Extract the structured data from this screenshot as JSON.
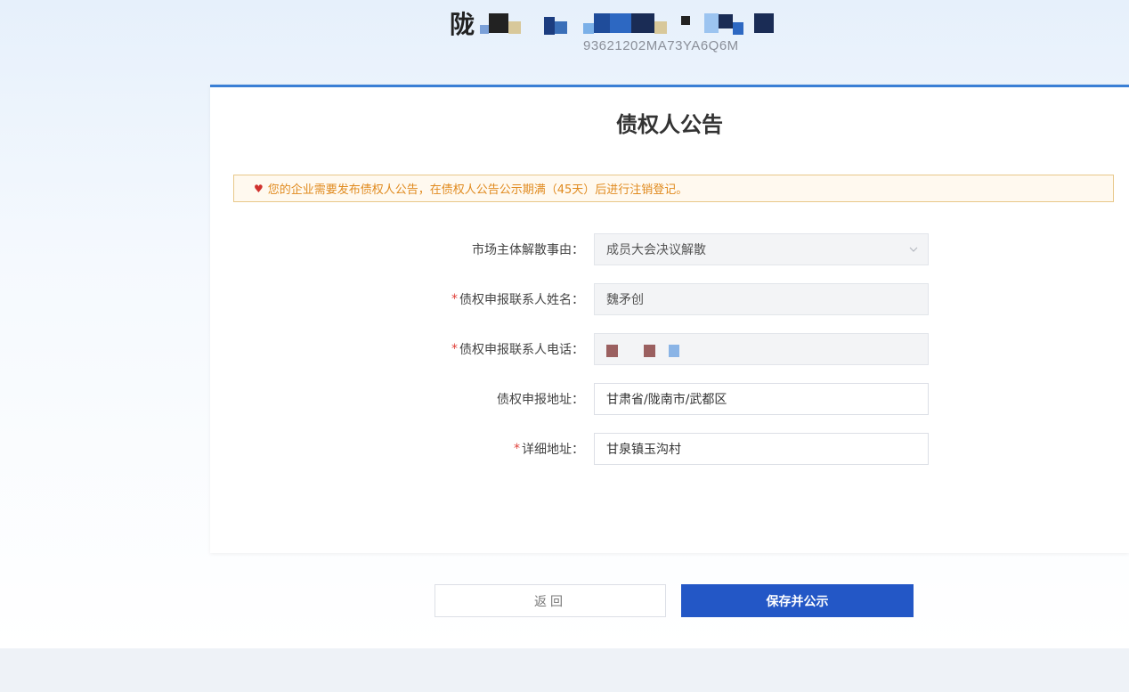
{
  "header": {
    "company_first_char": "陇",
    "credit_code": "93621202MA73YA6Q6M"
  },
  "panel": {
    "title": "债权人公告",
    "notice": "您的企业需要发布债权人公告，在债权人公告公示期满（45天）后进行注销登记。"
  },
  "form": {
    "dissolution_reason": {
      "label": "市场主体解散事由：",
      "required": false,
      "value": "成员大会决议解散"
    },
    "contact_name": {
      "label": "债权申报联系人姓名：",
      "required": true,
      "value": "魏矛创"
    },
    "contact_phone": {
      "label": "债权申报联系人电话：",
      "required": true,
      "value": ""
    },
    "declare_address": {
      "label": "债权申报地址：",
      "required": false,
      "value": "甘肃省/陇南市/武都区"
    },
    "detail_address": {
      "label": "详细地址：",
      "required": true,
      "value": "甘泉镇玉沟村"
    },
    "required_mark": "*"
  },
  "buttons": {
    "back_label": "返回",
    "save_label": "保存并公示"
  },
  "colors": {
    "accent": "#2357c6",
    "panel_border": "#3a7fd5",
    "notice_text": "#e08a1e",
    "required": "#e0413a"
  }
}
